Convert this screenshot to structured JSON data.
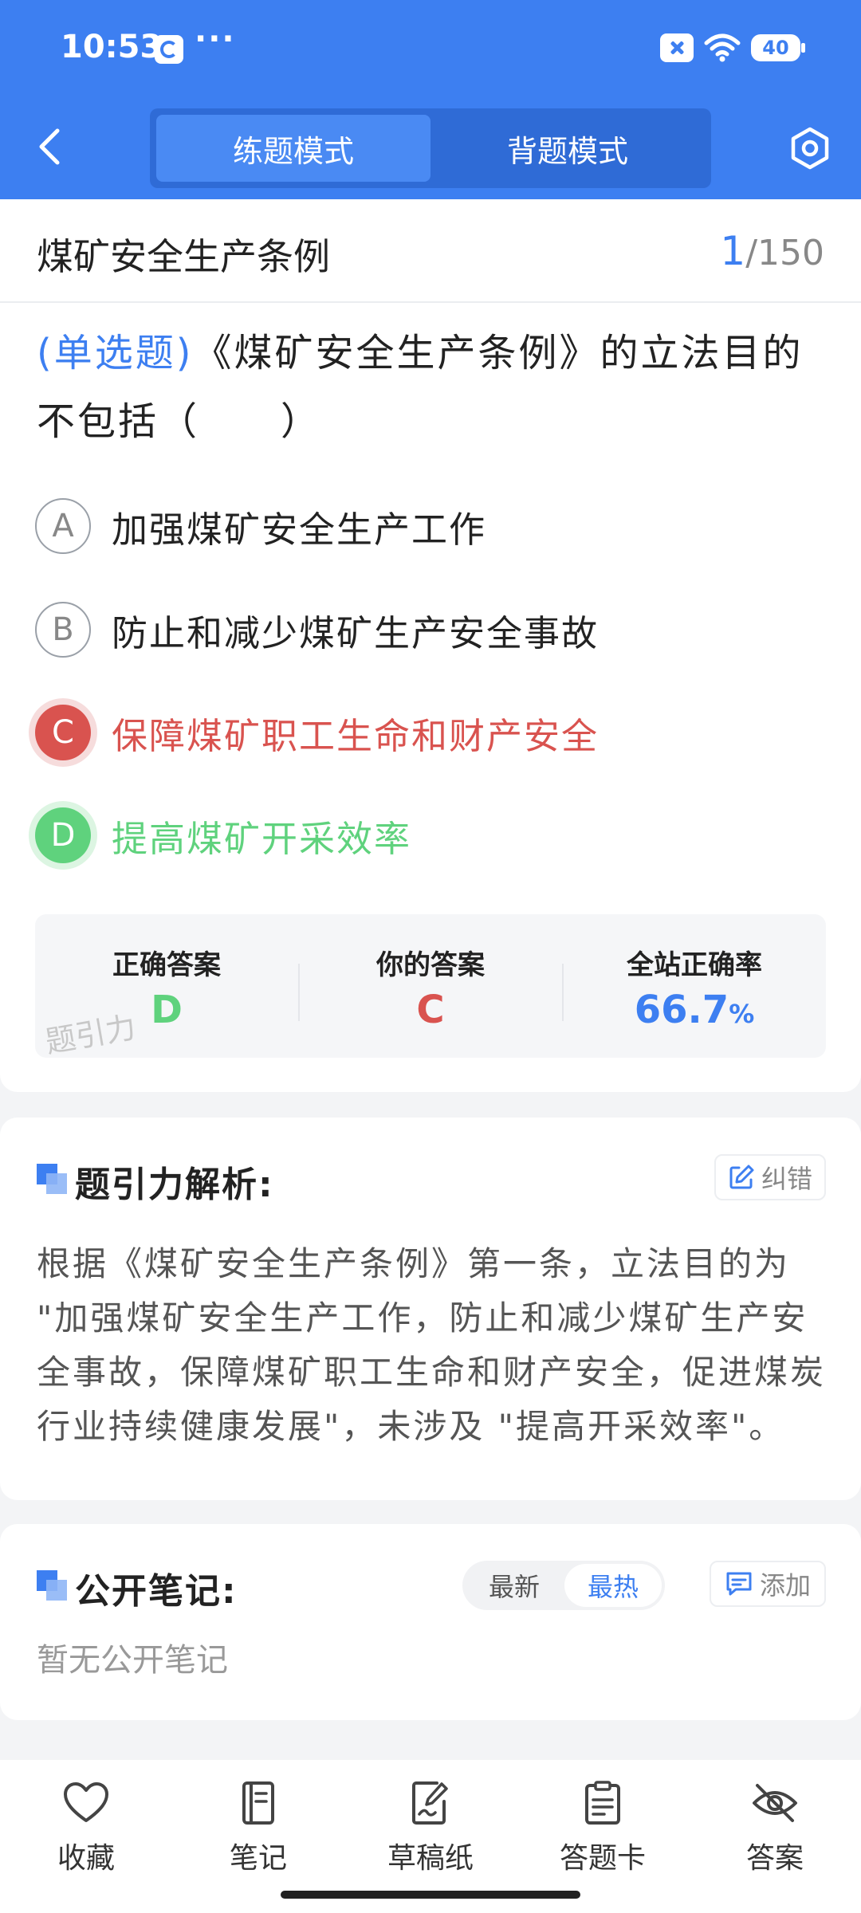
{
  "status_bar": {
    "time": "10:53",
    "dots": "···",
    "battery": "40"
  },
  "header": {
    "tabs": [
      {
        "label": "练题模式",
        "active": true
      },
      {
        "label": "背题模式",
        "active": false
      }
    ]
  },
  "question": {
    "category": "煤矿安全生产条例",
    "current": "1",
    "total": "/150",
    "type_label": "(单选题)",
    "text": "《煤矿安全生产条例》的立法目的不包括（　　）",
    "options": [
      {
        "letter": "A",
        "text": "加强煤矿安全生产工作",
        "state": "normal"
      },
      {
        "letter": "B",
        "text": "防止和减少煤矿生产安全事故",
        "state": "normal"
      },
      {
        "letter": "C",
        "text": "保障煤矿职工生命和财产安全",
        "state": "wrong"
      },
      {
        "letter": "D",
        "text": "提高煤矿开采效率",
        "state": "correct"
      }
    ]
  },
  "answer_panel": {
    "correct_label": "正确答案",
    "correct_value": "D",
    "yours_label": "你的答案",
    "yours_value": "C",
    "rate_label": "全站正确率",
    "rate_value": "66.7",
    "rate_unit": "%",
    "watermark": "题引力"
  },
  "analysis": {
    "title": "题引力解析:",
    "report_label": "纠错",
    "text": "根据《煤矿安全生产条例》第一条，立法目的为 \"加强煤矿安全生产工作，防止和减少煤矿生产安全事故，保障煤矿职工生命和财产安全，促进煤炭行业持续健康发展\"，未涉及 \"提高开采效率\"。"
  },
  "notes": {
    "title": "公开笔记:",
    "sort_latest": "最新",
    "sort_hottest": "最热",
    "add_label": "添加",
    "empty_text": "暂无公开笔记"
  },
  "bottom_nav": [
    {
      "label": "收藏",
      "icon": "heart-icon"
    },
    {
      "label": "笔记",
      "icon": "notebook-icon"
    },
    {
      "label": "草稿纸",
      "icon": "draft-paper-icon"
    },
    {
      "label": "答题卡",
      "icon": "answer-card-icon"
    },
    {
      "label": "答案",
      "icon": "eye-off-icon"
    }
  ],
  "colors": {
    "primary": "#3d7ff1",
    "wrong": "#d9534f",
    "correct": "#5fd27d"
  }
}
